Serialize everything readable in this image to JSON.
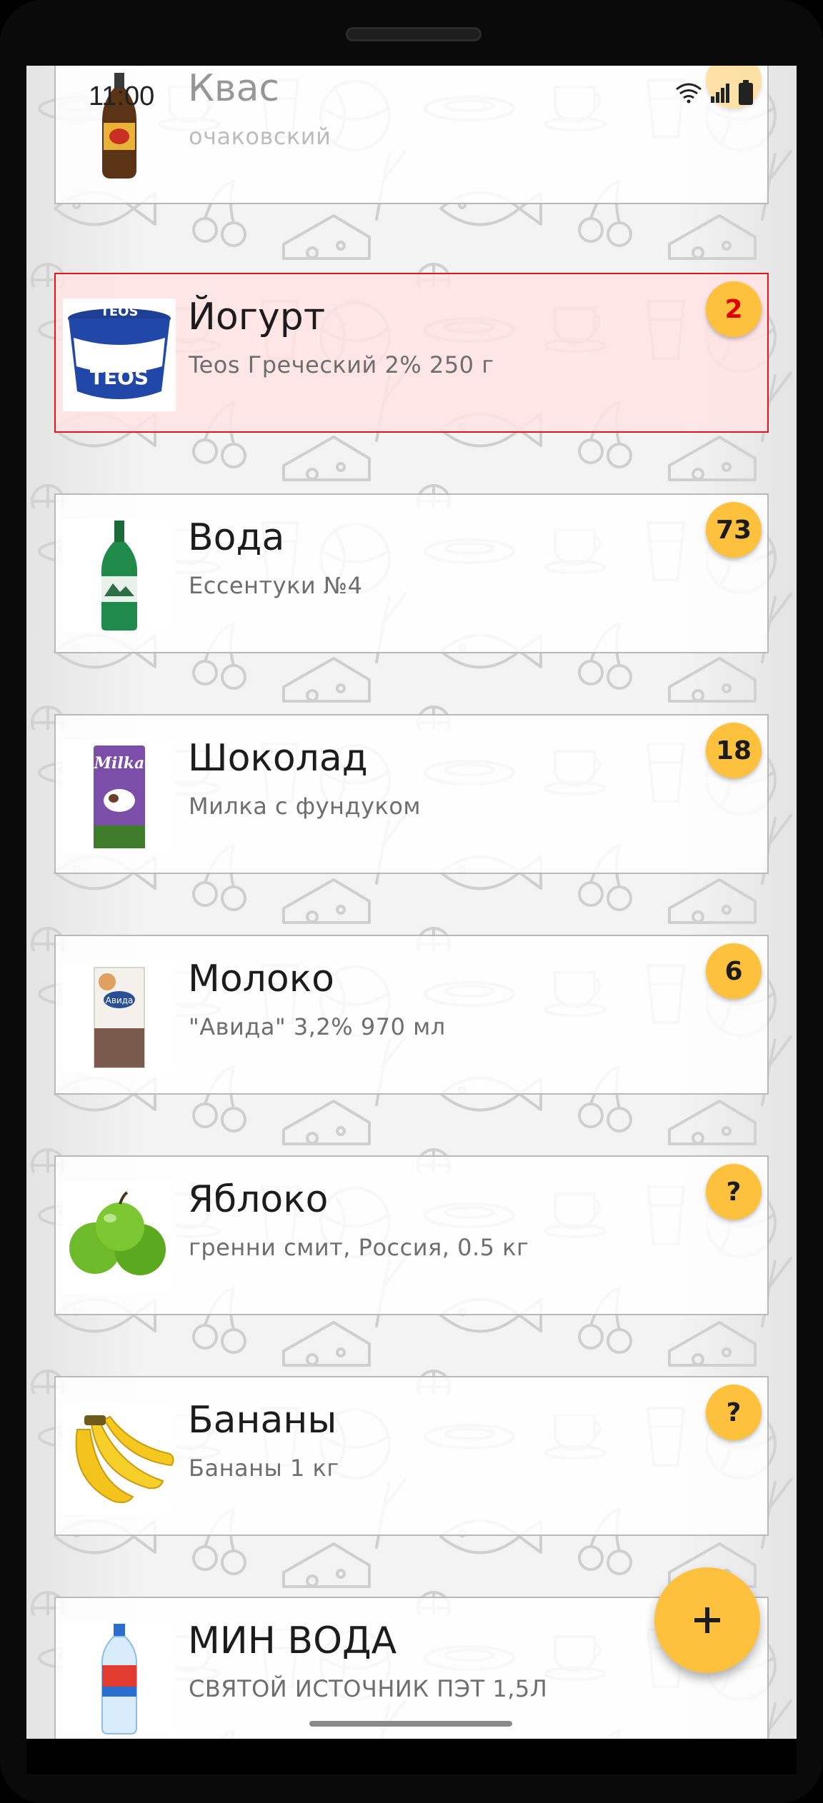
{
  "status_bar": {
    "time": "11:00"
  },
  "products": [
    {
      "title": "Квас",
      "subtitle": "очаковский",
      "image_icon": "kvass-bottle-icon",
      "badge": "",
      "selected": false
    },
    {
      "title": "Йогурт",
      "subtitle": "Teos Греческий 2% 250 г",
      "image_icon": "yogurt-cup-icon",
      "badge": "2",
      "selected": true
    },
    {
      "title": "Вода",
      "subtitle": "Ессентуки №4",
      "image_icon": "water-bottle-icon",
      "badge": "73",
      "selected": false
    },
    {
      "title": "Шоколад",
      "subtitle": "Милка с фундуком",
      "image_icon": "chocolate-bar-icon",
      "badge": "18",
      "selected": false
    },
    {
      "title": "Молоко",
      "subtitle": "\"Авида\" 3,2% 970 мл",
      "image_icon": "milk-carton-icon",
      "badge": "6",
      "selected": false
    },
    {
      "title": "Яблоко",
      "subtitle": "гренни смит, Россия, 0.5 кг",
      "image_icon": "green-apples-icon",
      "badge": "?",
      "selected": false
    },
    {
      "title": "Бананы",
      "subtitle": "Бананы 1 кг",
      "image_icon": "bananas-icon",
      "badge": "?",
      "selected": false
    },
    {
      "title": "МИН ВОДА",
      "subtitle": "СВЯТОЙ ИСТОЧНИК ПЭТ 1,5Л",
      "image_icon": "mineral-water-bottle-icon",
      "badge": "",
      "selected": false
    }
  ],
  "fab": {
    "label": "+",
    "icon": "plus-icon"
  },
  "colors": {
    "accent": "#fec13e",
    "selected_border": "#e0161b",
    "selected_fill": "#ffe4e4",
    "alert_text": "#e00000"
  }
}
